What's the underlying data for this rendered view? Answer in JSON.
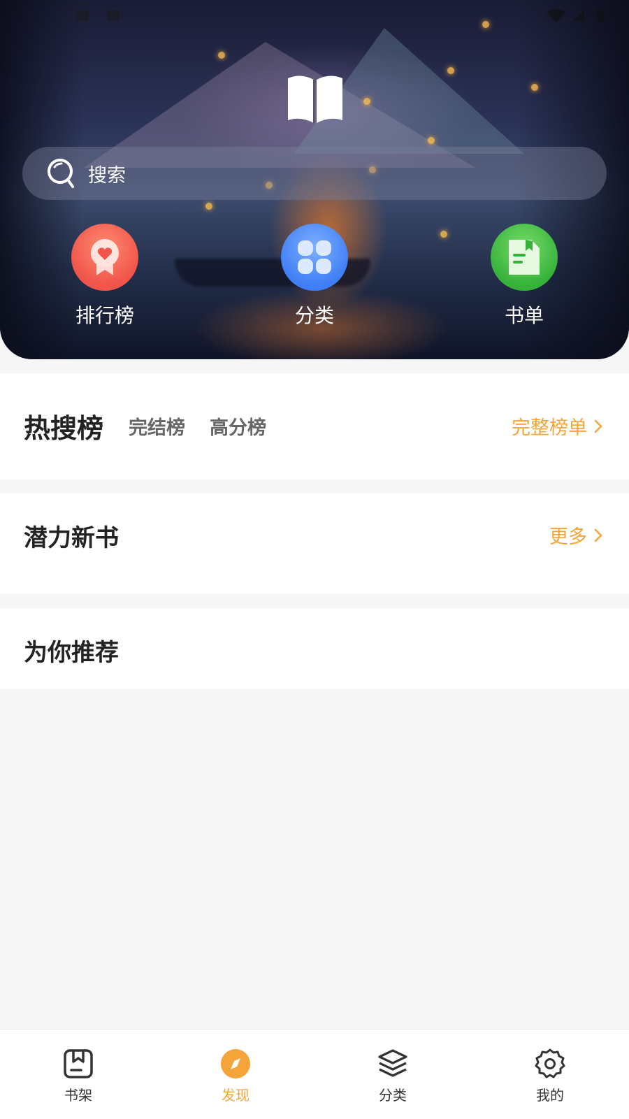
{
  "header": {
    "search_placeholder": "搜索",
    "quick_links": [
      {
        "label": "排行榜",
        "icon": "ranking-medal-icon",
        "color": "#f0544a"
      },
      {
        "label": "分类",
        "icon": "category-grid-icon",
        "color": "#3f7ef5"
      },
      {
        "label": "书单",
        "icon": "booklist-icon",
        "color": "#3cb83a"
      }
    ]
  },
  "hot_section": {
    "title": "热搜榜",
    "tabs": [
      "完结榜",
      "高分榜"
    ],
    "more": "完整榜单"
  },
  "new_section": {
    "title": "潜力新书",
    "more": "更多"
  },
  "recommend_section": {
    "title": "为你推荐"
  },
  "bottom_nav": {
    "items": [
      {
        "label": "书架",
        "icon": "bookshelf-icon"
      },
      {
        "label": "发现",
        "icon": "compass-icon",
        "active": true
      },
      {
        "label": "分类",
        "icon": "layers-icon"
      },
      {
        "label": "我的",
        "icon": "settings-gear-icon"
      }
    ]
  },
  "colors": {
    "accent": "#f5a43a",
    "text_primary": "#222222",
    "text_secondary": "#666666",
    "background": "#f6f6f6"
  }
}
